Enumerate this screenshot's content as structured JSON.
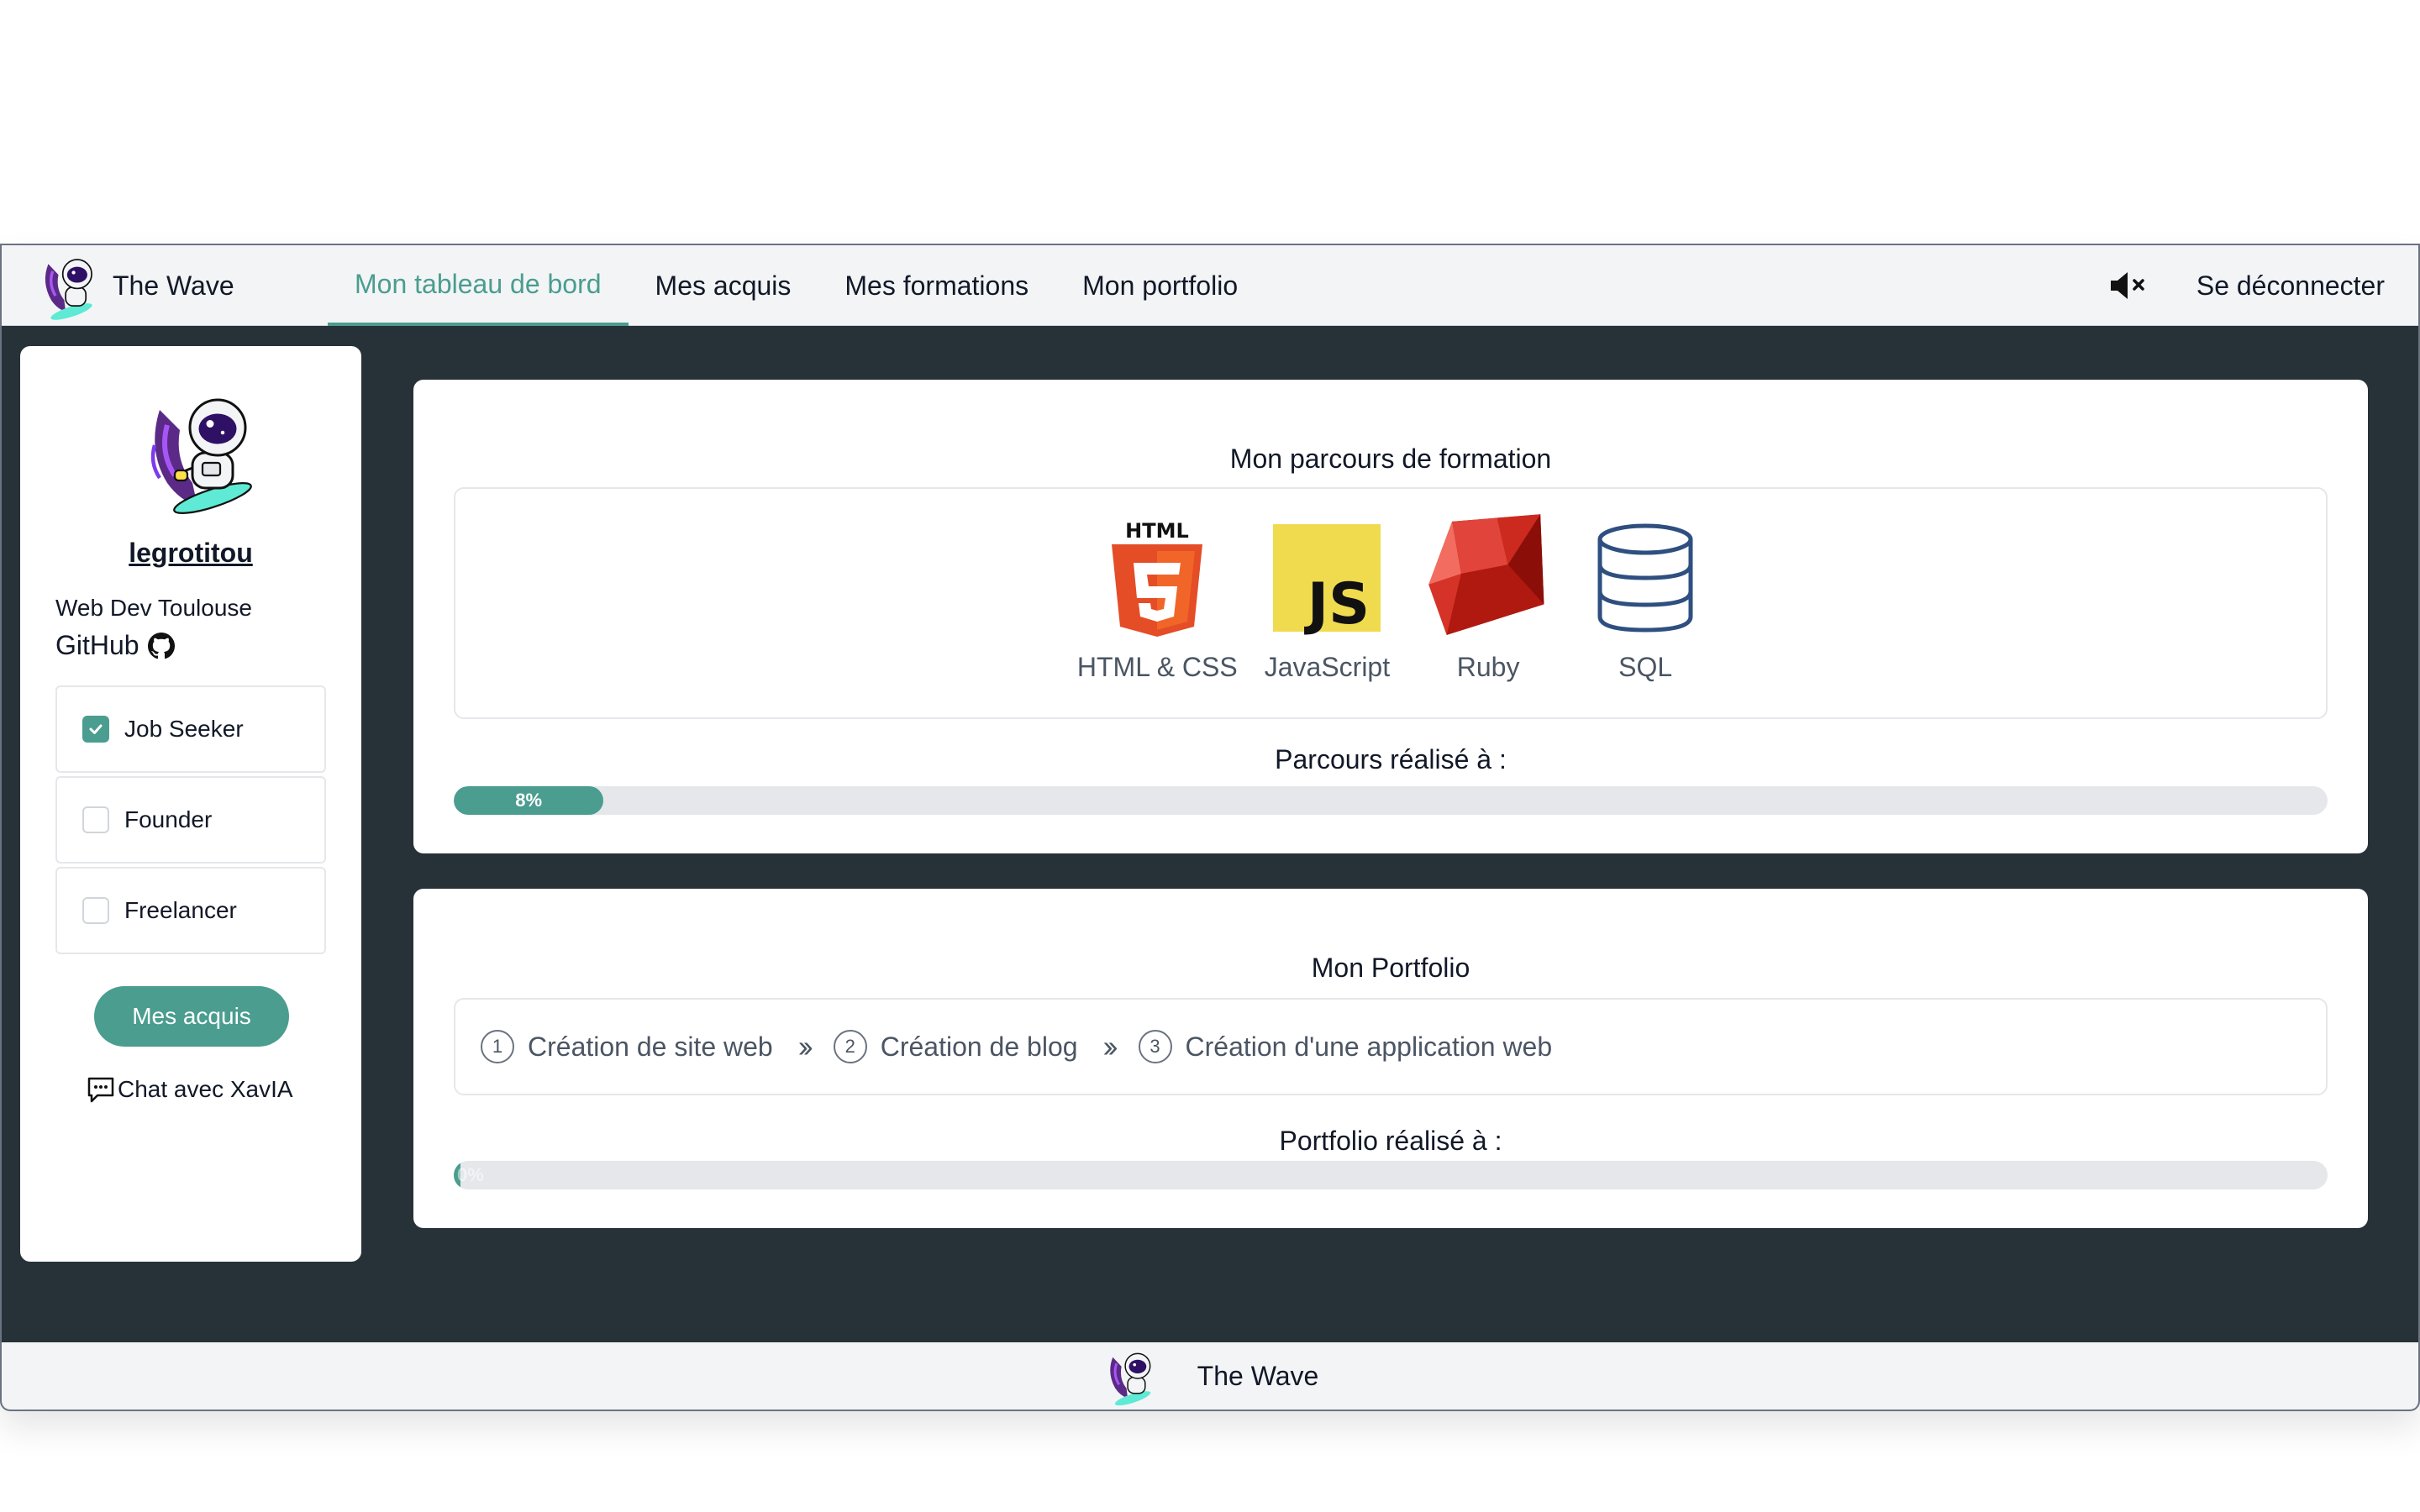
{
  "brand": {
    "name": "The Wave"
  },
  "nav": {
    "links": [
      {
        "label": "Mon tableau de bord",
        "active": true
      },
      {
        "label": "Mes acquis",
        "active": false
      },
      {
        "label": "Mes formations",
        "active": false
      },
      {
        "label": "Mon portfolio",
        "active": false
      }
    ],
    "mute_icon": "speaker-mute-icon",
    "logout": "Se déconnecter"
  },
  "sidebar": {
    "username": "legrotitou",
    "bio": "Web Dev Toulouse",
    "github": "GitHub",
    "statuses": [
      {
        "label": "Job Seeker",
        "checked": true
      },
      {
        "label": "Founder",
        "checked": false
      },
      {
        "label": "Freelancer",
        "checked": false
      }
    ],
    "button": "Mes acquis",
    "chat": "Chat avec XavIA"
  },
  "training": {
    "title": "Mon parcours de formation",
    "languages": [
      {
        "name": "HTML & CSS",
        "icon": "html5-icon",
        "logo_text": "HTML"
      },
      {
        "name": "JavaScript",
        "icon": "javascript-icon",
        "logo_text": "JS"
      },
      {
        "name": "Ruby",
        "icon": "ruby-icon"
      },
      {
        "name": "SQL",
        "icon": "database-icon"
      }
    ],
    "progress_label": "Parcours réalisé à :",
    "progress_value": 8,
    "progress_text": "8%"
  },
  "portfolio": {
    "title": "Mon Portfolio",
    "steps": [
      {
        "num": "1",
        "label": "Création de site web"
      },
      {
        "num": "2",
        "label": "Création de blog"
      },
      {
        "num": "3",
        "label": "Création d'une application web"
      }
    ],
    "progress_label": "Portfolio réalisé à :",
    "progress_value": 0,
    "progress_text": "0%"
  },
  "footer": {
    "name": "The Wave"
  },
  "colors": {
    "accent": "#4a9d8f",
    "background": "#263238",
    "nav": "#f3f4f6"
  }
}
